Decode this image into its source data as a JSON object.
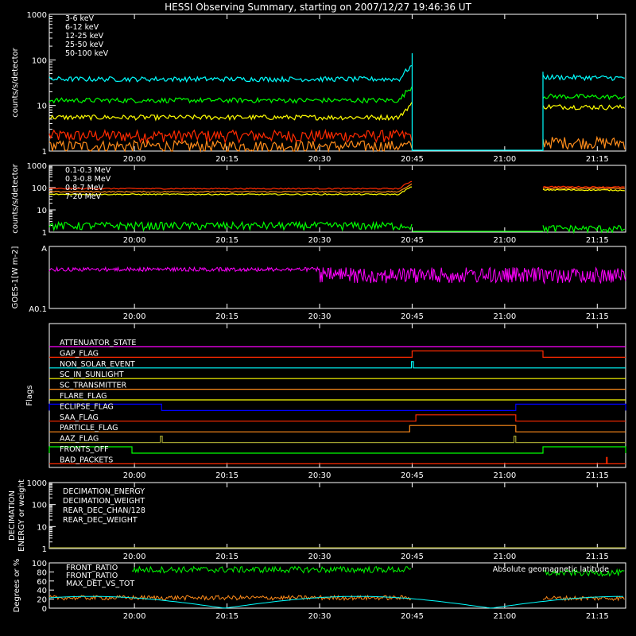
{
  "title": "HESSI Observing Summary, starting on 2007/12/27 19:46:36 UT",
  "chart_data": [
    {
      "type": "line",
      "ylabel": "counts/s/detector",
      "yscale": "log",
      "ylim": [
        1,
        1000
      ],
      "ytick_labels": [
        "1",
        "10",
        "100",
        "1000"
      ],
      "xlim_minutes": [
        19.6,
        113.0
      ],
      "x_tick_labels": [
        "20:00",
        "20:15",
        "20:30",
        "20:45",
        "21:00",
        "21:15"
      ],
      "x_tick_minutes": [
        33.4,
        48.4,
        63.4,
        78.4,
        93.4,
        108.4
      ],
      "gap_minutes": [
        78.4,
        99.6
      ],
      "series": [
        {
          "name": "3-6 keV",
          "color": "#ff2a00",
          "pre": 2.2,
          "post": null
        },
        {
          "name": "6-12 keV",
          "color": "#ff8c1a",
          "pre": 1.3,
          "post": 1.6
        },
        {
          "name": "12-25 keV",
          "color": "#ffff00",
          "pre": 5.5,
          "post": 9.5
        },
        {
          "name": "25-50 keV",
          "color": "#00ff00",
          "pre": 13,
          "post": 16
        },
        {
          "name": "50-100 keV",
          "color": "#00ffff",
          "pre": 38,
          "post": 42
        }
      ]
    },
    {
      "type": "line",
      "ylabel": "counts/s/detector",
      "yscale": "log",
      "ylim": [
        1,
        1000
      ],
      "ytick_labels": [
        "1",
        "10",
        "100",
        "1000"
      ],
      "series": [
        {
          "name": "0.1-0.3 MeV",
          "color": "#ff2a00",
          "pre": 90,
          "post": 110
        },
        {
          "name": "0.3-0.8 MeV",
          "color": "#ff8c1a",
          "pre": 65,
          "post": 95
        },
        {
          "name": "0.8-7 MeV",
          "color": "#ffff00",
          "pre": 50,
          "post": 80
        },
        {
          "name": "7-20 MeV",
          "color": "#00ff00",
          "pre": 2,
          "post": 1.5
        }
      ]
    },
    {
      "type": "line",
      "ylabel": "GOES-1[W m-2]",
      "ytick_labels": [
        "A",
        "A0.1"
      ],
      "series": [
        {
          "name": "GOES",
          "color": "#ff00ff",
          "level": 0.35
        }
      ]
    },
    {
      "type": "line",
      "ylabel": "Flags",
      "flags": [
        {
          "name": "ATTENUATOR_STATE",
          "color": "#ff00ff",
          "steps": []
        },
        {
          "name": "GAP_FLAG",
          "color": "#ff2a00",
          "steps": [
            [
              78.4,
              99.6
            ]
          ]
        },
        {
          "name": "NON_SOLAR_EVENT",
          "color": "#00ffff",
          "steps": [
            [
              78.3,
              78.6
            ]
          ]
        },
        {
          "name": "SC_IN_SUNLIGHT",
          "color": "#ffff00",
          "steps": [
            [
              -100,
              0
            ]
          ]
        },
        {
          "name": "SC_TRANSMITTER",
          "color": "#ff8c1a",
          "steps": []
        },
        {
          "name": "FLARE_FLAG",
          "color": "#ffff00",
          "steps": []
        },
        {
          "name": "ECLIPSE_FLAG",
          "color": "#0000ff",
          "steps": [
            [
              19.6,
              37.8
            ],
            [
              95.2,
              113.0
            ]
          ]
        },
        {
          "name": "SAA_FLAG",
          "color": "#ff2a00",
          "steps": [
            [
              79.0,
              95.2
            ]
          ]
        },
        {
          "name": "PARTICLE_FLAG",
          "color": "#ff8c1a",
          "steps": [
            [
              78.0,
              95.2
            ]
          ]
        },
        {
          "name": "AAZ_FLAG",
          "color": "#a0a030",
          "steps": [
            [
              37.6,
              37.9
            ],
            [
              94.9,
              95.2
            ]
          ]
        },
        {
          "name": "FRONTS_OFF",
          "color": "#00ff00",
          "steps": [
            [
              19.6,
              33.0
            ],
            [
              99.6,
              113.0
            ]
          ]
        },
        {
          "name": "BAD_PACKETS",
          "color": "#ff2a00",
          "steps": [
            [
              109.9,
              110.0
            ]
          ]
        }
      ]
    },
    {
      "type": "line",
      "ylabel_lines": [
        "DECIMATION",
        "ENERGY or weight"
      ],
      "ytick_labels": [
        "1",
        "10",
        "100",
        "1000"
      ],
      "series": [
        {
          "name": "DECIMATION_ENERGY",
          "color": "#00ff00"
        },
        {
          "name": "DECIMATION_WEIGHT",
          "color": "#ff8c1a"
        },
        {
          "name": "REAR_DEC_CHAN/128",
          "color": "#00ffff"
        },
        {
          "name": "REAR_DEC_WEIGHT",
          "color": "#a0a030"
        }
      ]
    },
    {
      "type": "line",
      "ylabel": "Degrees or %",
      "ylim": [
        0,
        100
      ],
      "ytick_labels": [
        "0",
        "20",
        "40",
        "60",
        "80",
        "100"
      ],
      "annotation": "Absolute geomagnetic latitude",
      "series": [
        {
          "name": "FRONT_RATIO",
          "color": "#ffff00"
        },
        {
          "name": "FRONT_RATIO",
          "color": "#00ff00",
          "pre": 85,
          "post": 78
        },
        {
          "name": "MAX_DET_VS_TOT",
          "color": "#ff8c1a",
          "pre": 23,
          "post": 22
        },
        {
          "name": "Absolute geomagnetic latitude",
          "color": "#00ffff"
        }
      ]
    }
  ]
}
